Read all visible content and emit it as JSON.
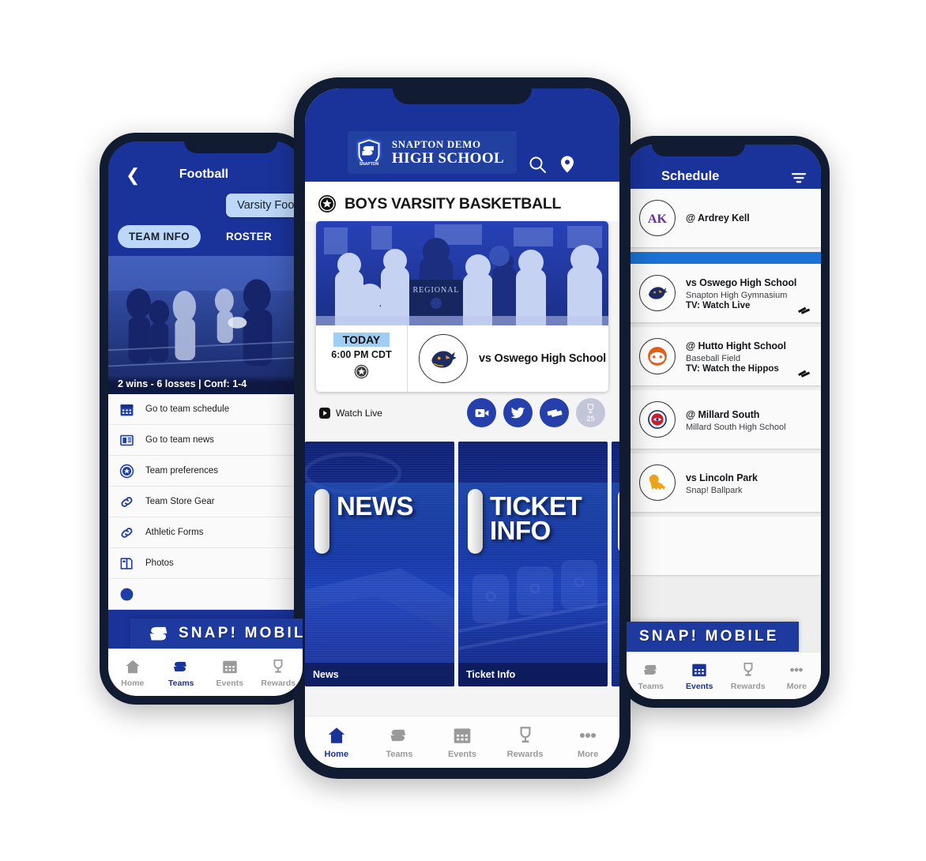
{
  "app": {
    "brand": "SNAP! MOBILE",
    "accent_blue": "#1a339a",
    "light_blue": "#bcd7f7",
    "ghost_gray": "#c3c6d8"
  },
  "left_phone": {
    "back_icon": "chevron-left-icon",
    "title": "Football",
    "team_chip": "Varsity Football",
    "tabs": [
      {
        "label": "TEAM INFO",
        "active": true
      },
      {
        "label": "ROSTER",
        "active": false
      }
    ],
    "record": "2 wins - 6 losses | Conf: 1-4",
    "hero_alt": "football-game-photo",
    "menu": [
      {
        "label": "Go to team schedule",
        "icon": "calendar-icon"
      },
      {
        "label": "Go to team news",
        "icon": "news-icon"
      },
      {
        "label": "Team preferences",
        "icon": "star-circle-icon"
      },
      {
        "label": "Team Store Gear",
        "icon": "link-icon"
      },
      {
        "label": "Athletic Forms",
        "icon": "link-icon"
      },
      {
        "label": "Photos",
        "icon": "book-icon"
      }
    ],
    "banner": "SNAP! MOBILE",
    "nav": [
      {
        "label": "Home",
        "icon": "home-icon",
        "active": false
      },
      {
        "label": "Teams",
        "icon": "snap-s-icon",
        "active": true
      },
      {
        "label": "Events",
        "icon": "calendar-icon",
        "active": false
      },
      {
        "label": "Rewards",
        "icon": "trophy-icon",
        "active": false
      }
    ]
  },
  "center_phone": {
    "header": {
      "school_line1": "SNAPTON DEMO",
      "school_line2": "HIGH SCHOOL",
      "shield_icon": "snapton-shield-icon",
      "search_icon": "search-icon",
      "location_icon": "location-pin-icon"
    },
    "section_title": "BOYS VARSITY BASKETBALL",
    "section_icon": "star-circle-icon",
    "game": {
      "photo_alt": "basketball-team-celebration-photo",
      "day": "TODAY",
      "time": "6:00 PM CDT",
      "star_icon": "star-circle-icon",
      "opponent": "vs Oswego High School",
      "opponent_logo": "panther-logo-icon"
    },
    "watch_live": "Watch Live",
    "watch_live_icon": "play-badge-icon",
    "actions": [
      {
        "icon": "video-camera-icon",
        "style": "solid"
      },
      {
        "icon": "twitter-bird-icon",
        "style": "solid"
      },
      {
        "icon": "tickets-icon",
        "style": "solid"
      },
      {
        "icon": "trophy-icon",
        "style": "ghost",
        "count": "25"
      }
    ],
    "tiles": [
      {
        "big_label": "NEWS",
        "foot_label": "News"
      },
      {
        "big_label": "TICKET INFO",
        "foot_label": "Ticket Info"
      },
      {
        "big_label": "",
        "foot_label": ""
      }
    ],
    "nav": [
      {
        "label": "Home",
        "icon": "home-icon",
        "active": true
      },
      {
        "label": "Teams",
        "icon": "snap-s-icon",
        "active": false
      },
      {
        "label": "Events",
        "icon": "calendar-icon",
        "active": false
      },
      {
        "label": "Rewards",
        "icon": "trophy-icon",
        "active": false
      },
      {
        "label": "More",
        "icon": "more-dots-icon",
        "active": false
      }
    ]
  },
  "right_phone": {
    "title": "Schedule",
    "filter_icon": "filter-icon",
    "games": [
      {
        "opponent": "@ Ardrey Kell",
        "venue": "",
        "tv": "",
        "logo": "ardrey-kell-logo-icon",
        "ticket": false
      },
      {
        "opponent": "vs Oswego High School",
        "venue": "Snapton High Gymnasium",
        "tv": "TV: Watch Live",
        "logo": "panther-logo-icon",
        "ticket": true
      },
      {
        "opponent": "@ Hutto Hight School",
        "venue": "Baseball Field",
        "tv": "TV: Watch the Hippos",
        "logo": "hippo-logo-icon",
        "ticket": true
      },
      {
        "opponent": "@ Millard South",
        "venue": "Millard South High School",
        "tv": "",
        "logo": "millard-south-logo-icon",
        "ticket": false
      },
      {
        "opponent": "vs Lincoln Park",
        "venue": "Snap! Ballpark",
        "tv": "",
        "logo": "lion-logo-icon",
        "ticket": false
      }
    ],
    "banner": "SNAP! MOBILE",
    "nav": [
      {
        "label": "Teams",
        "icon": "snap-s-icon",
        "active": false
      },
      {
        "label": "Events",
        "icon": "calendar-icon",
        "active": true
      },
      {
        "label": "Rewards",
        "icon": "trophy-icon",
        "active": false
      },
      {
        "label": "More",
        "icon": "more-dots-icon",
        "active": false
      }
    ]
  }
}
